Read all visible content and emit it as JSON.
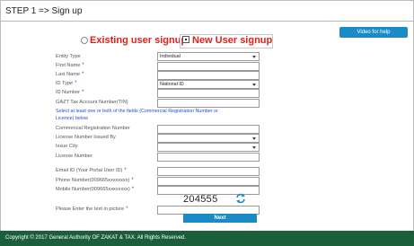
{
  "page": {
    "title": "STEP 1 => Sign up"
  },
  "help_button": {
    "label": "Video for help"
  },
  "signup_type": {
    "existing_label": "Existing user signup",
    "new_label": "New User signup"
  },
  "form": {
    "entity_type": {
      "label": "Entity Type",
      "value": "Individual"
    },
    "first_name": {
      "label": "First Name",
      "value": ""
    },
    "last_name": {
      "label": "Last Name",
      "value": ""
    },
    "id_type": {
      "label": "ID Type",
      "value": "National ID"
    },
    "id_number": {
      "label": "ID Number",
      "value": ""
    },
    "tin": {
      "label": "GAZT Tax Account Number(TIN)",
      "value": ""
    },
    "note": "Select at least one or both of the fields (Commercial Registration Number or Licence) below",
    "commercial_registration_number": {
      "label": "Commercial Registration Number",
      "value": ""
    },
    "license_number_issued_by": {
      "label": "License Number Issued By",
      "value": ""
    },
    "issue_city": {
      "label": "Issue City",
      "value": ""
    },
    "license_number": {
      "label": "License Number",
      "value": ""
    },
    "email": {
      "label": "Email ID (Your Portal User ID)",
      "value": ""
    },
    "phone": {
      "label": "Phone Number(009665xxxxxxxx)",
      "value": ""
    },
    "mobile": {
      "label": "Mobile Number(009665xxxxxxxx)",
      "value": ""
    },
    "captcha_code": "204555",
    "captcha_input": {
      "label": "Please Enter the text in picture",
      "value": ""
    },
    "required_mark": "*",
    "next_label": "Next"
  },
  "footer": {
    "text": "Copyright © 2017 General Authority OF ZAKAT & TAX. All Rights Reserved."
  },
  "colors": {
    "accent": "#1b8bc7",
    "footer": "#1a5e3a",
    "signup_text": "#e0201b",
    "note": "#1b4fd4"
  }
}
